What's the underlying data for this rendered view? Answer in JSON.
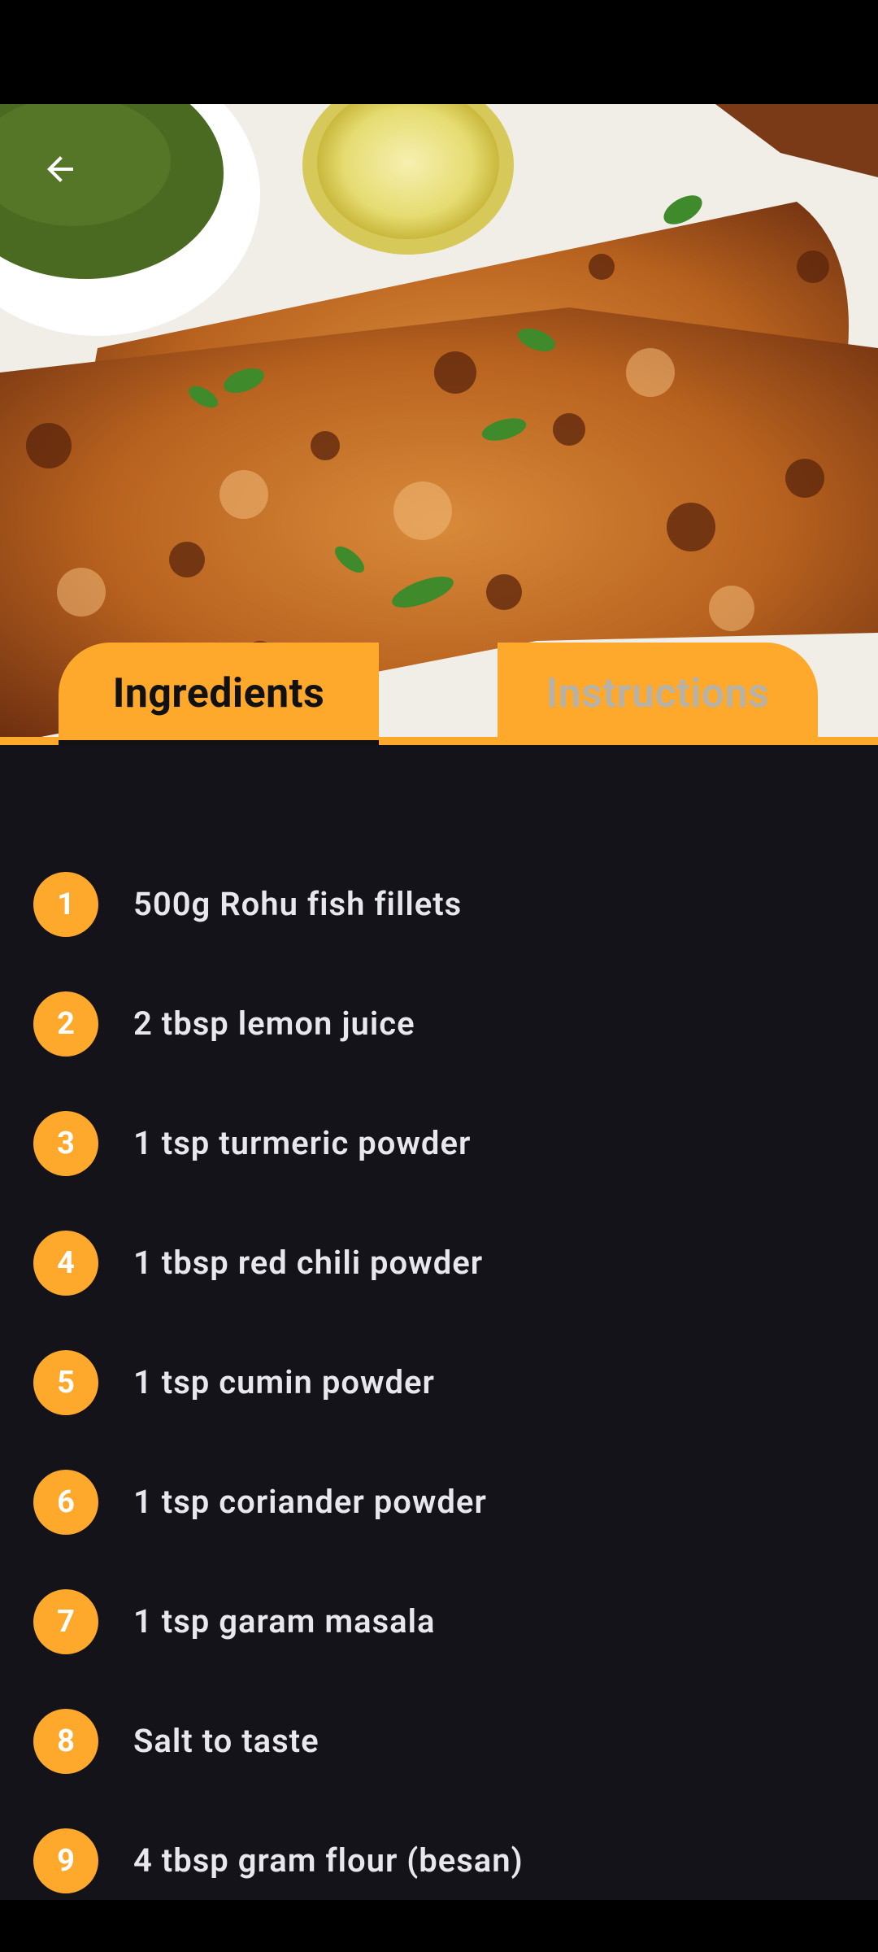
{
  "header": {
    "back_icon": "arrow-left-icon"
  },
  "hero_image": {
    "subject": "fried fish fillets with green chutney and lemon"
  },
  "tabs": [
    {
      "label": "Ingredients",
      "selected": true
    },
    {
      "label": "Instructions",
      "selected": false
    }
  ],
  "ingredients": [
    {
      "number": "1",
      "text": "500g Rohu fish fillets"
    },
    {
      "number": "2",
      "text": "2 tbsp lemon juice"
    },
    {
      "number": "3",
      "text": "1 tsp turmeric powder"
    },
    {
      "number": "4",
      "text": "1 tbsp red chili powder"
    },
    {
      "number": "5",
      "text": "1 tsp cumin powder"
    },
    {
      "number": "6",
      "text": "1 tsp coriander powder"
    },
    {
      "number": "7",
      "text": "1 tsp garam masala"
    },
    {
      "number": "8",
      "text": "Salt to taste"
    },
    {
      "number": "9",
      "text": "4 tbsp gram flour (besan)"
    }
  ],
  "colors": {
    "accent": "#fea82c",
    "background": "#15131a",
    "text": "#e9e7ee"
  }
}
